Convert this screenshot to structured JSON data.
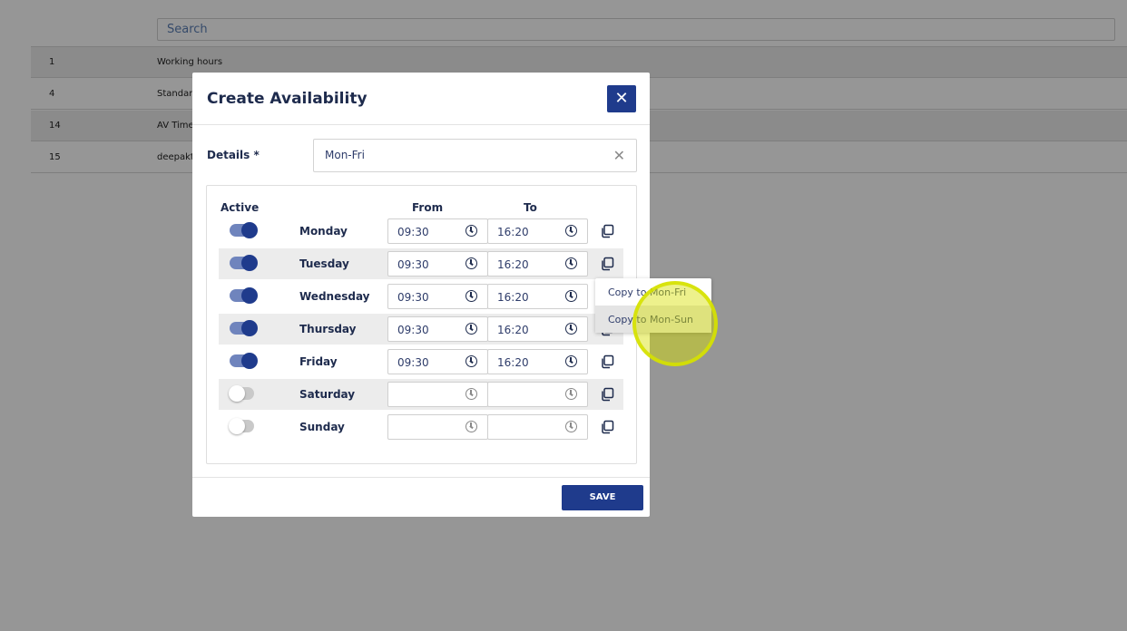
{
  "search": {
    "placeholder": "Search"
  },
  "background_rows": [
    {
      "id": "1",
      "name": "Working hours"
    },
    {
      "id": "4",
      "name": "Standard"
    },
    {
      "id": "14",
      "name": "AV Time"
    },
    {
      "id": "15",
      "name": "deepakt"
    }
  ],
  "modal": {
    "title": "Create Availability",
    "close_icon": "close-icon",
    "details_label": "Details *",
    "details_value": "Mon-Fri",
    "columns": {
      "active": "Active",
      "from": "From",
      "to": "To"
    },
    "days": [
      {
        "name": "Monday",
        "active": true,
        "from": "09:30",
        "to": "16:20"
      },
      {
        "name": "Tuesday",
        "active": true,
        "from": "09:30",
        "to": "16:20"
      },
      {
        "name": "Wednesday",
        "active": true,
        "from": "09:30",
        "to": "16:20"
      },
      {
        "name": "Thursday",
        "active": true,
        "from": "09:30",
        "to": "16:20"
      },
      {
        "name": "Friday",
        "active": true,
        "from": "09:30",
        "to": "16:20"
      },
      {
        "name": "Saturday",
        "active": false,
        "from": "",
        "to": ""
      },
      {
        "name": "Sunday",
        "active": false,
        "from": "",
        "to": ""
      }
    ],
    "save_label": "SAVE"
  },
  "copy_menu": {
    "items": [
      "Copy to Mon-Fri",
      "Copy to Mon-Sun"
    ]
  },
  "colors": {
    "primary": "#1f3b8c",
    "toggle_track_on": "#6f84bd",
    "click_highlight": "#d6e100"
  }
}
